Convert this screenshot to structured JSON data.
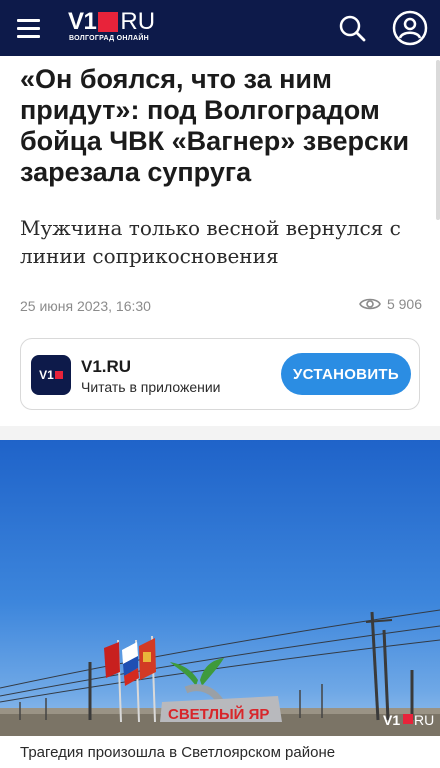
{
  "header": {
    "logo_v1": "V1",
    "logo_ru": "RU",
    "logo_subtitle": "ВОЛГОГРАД ОНЛАЙН",
    "bg_color": "#0d1a4a",
    "accent_color": "#e8233a",
    "icons": [
      "menu-icon",
      "search-icon",
      "user-icon"
    ]
  },
  "article": {
    "title": "«Он боялся, что за ним придут»: под Волгоградом бойца ЧВК «Вагнер» зверски зарезала супруга",
    "subtitle": "Мужчина только весной вернулся с линии соприкосновения",
    "date": "25 июня 2023, 16:30",
    "views": "5 906"
  },
  "app_banner": {
    "icon_text": "V1",
    "name": "V1.RU",
    "description": "Читать в приложении",
    "install_label": "УСТАНОВИТЬ",
    "button_color": "#2b8de3"
  },
  "photo": {
    "sign_text": "СВЕТЛЫЙ ЯР",
    "watermark_v1": "V1",
    "watermark_ru": "RU",
    "caption": "Трагедия произошла в Светлоярском районе"
  }
}
